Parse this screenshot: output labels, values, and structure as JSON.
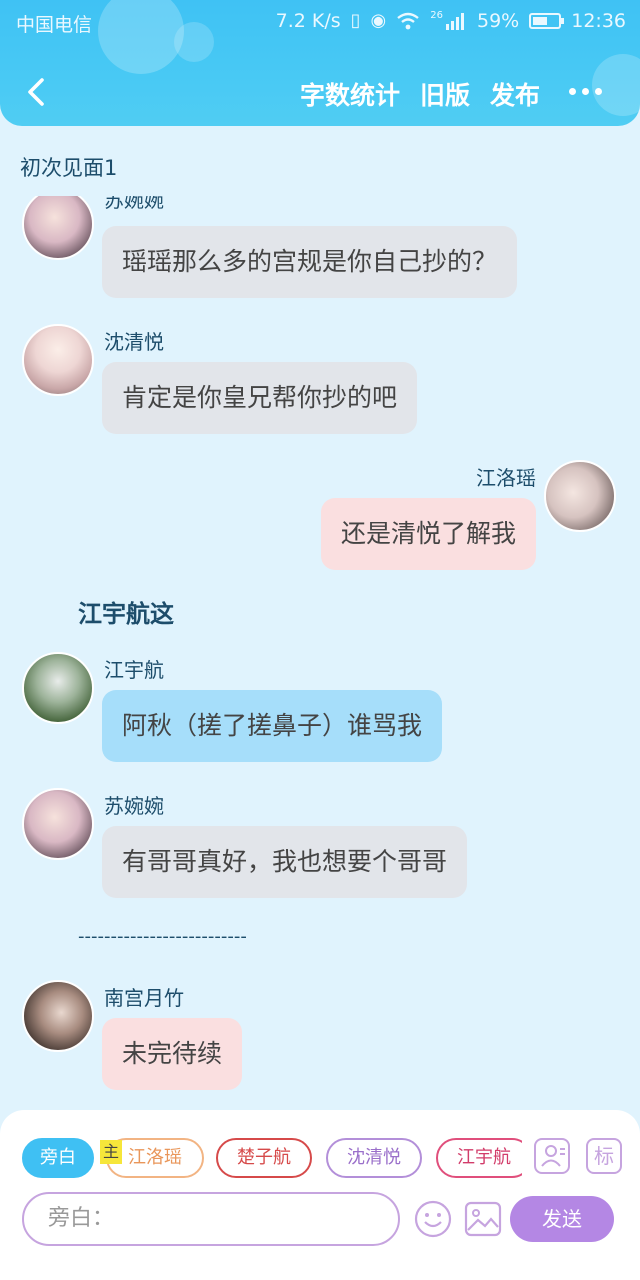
{
  "status": {
    "carrier": "中国电信",
    "speed": "7.2 K/s",
    "network": "26",
    "battery": "59%",
    "battery_level": 0.59,
    "time": "12:36"
  },
  "nav": {
    "action_count": "字数统计",
    "action_old": "旧版",
    "action_publish": "发布"
  },
  "chapter_title": "初次见面1",
  "messages": [
    {
      "name": "苏婉婉",
      "text": "瑶瑶那么多的宫规是你自己抄的？"
    },
    {
      "name": "沈清悦",
      "text": "肯定是你皇兄帮你抄的吧"
    },
    {
      "name": "江洛瑶",
      "text": "还是清悦了解我"
    },
    {
      "name": "江宇航",
      "text": "阿秋（搓了搓鼻子）谁骂我"
    },
    {
      "name": "苏婉婉",
      "text": "有哥哥真好，我也想要个哥哥"
    },
    {
      "name": "南宫月竹",
      "text": "未完待续"
    }
  ],
  "narration": "江宇航这",
  "divider": "--------------------------",
  "composer": {
    "chips": [
      "旁白",
      "江洛瑶",
      "楚子航",
      "沈清悦",
      "江宇航"
    ],
    "main_badge": "主",
    "tag_button": "标",
    "input_placeholder": "旁白：",
    "send_label": "发送"
  },
  "colors": {
    "header": "#3fc2f4",
    "background": "#e0f3fd",
    "bubble_gray": "#e2e5ea",
    "bubble_pink": "#fadfe0",
    "bubble_blue": "#a6defa",
    "accent_purple": "#b487e4"
  }
}
